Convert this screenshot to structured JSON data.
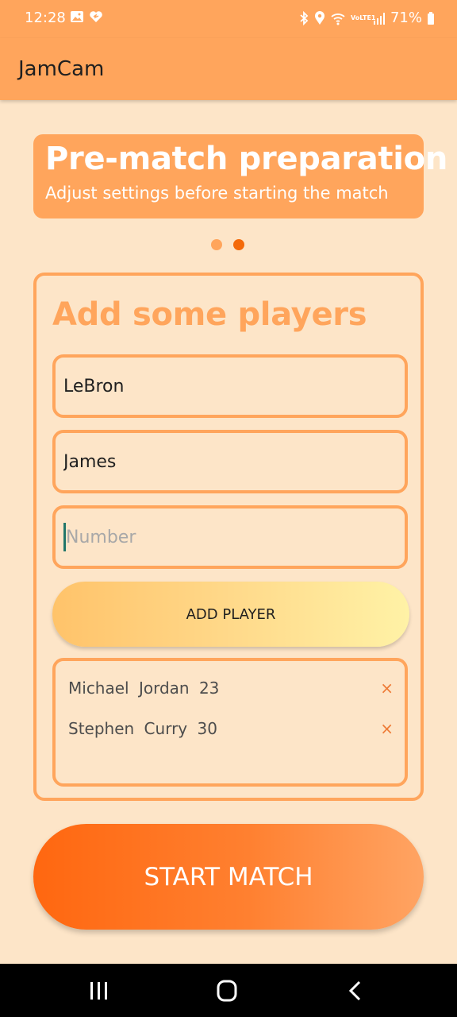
{
  "status_bar": {
    "time": "12:28",
    "battery": "71%",
    "icons": [
      "gallery-icon",
      "heart-icon",
      "bluetooth-icon",
      "location-icon",
      "wifi-icon",
      "volte-icon",
      "signal-icon",
      "battery-icon"
    ],
    "volte_text": "VoLTE1"
  },
  "app_bar": {
    "title": "JamCam"
  },
  "hero": {
    "title": "Pre-match preparation",
    "subtitle": "Adjust settings before starting the match"
  },
  "pager": {
    "total": 2,
    "active_index": 1
  },
  "card": {
    "title": "Add some players",
    "first_name_value": "LeBron",
    "last_name_value": "James",
    "number_placeholder": "Number",
    "add_button_label": "ADD PLAYER",
    "players": [
      {
        "label": "Michael  Jordan  23",
        "remove": "×"
      },
      {
        "label": "Stephen  Curry  30",
        "remove": "×"
      }
    ]
  },
  "start_button_label": "START MATCH",
  "nav": {
    "icons": [
      "recent-apps-icon",
      "home-icon",
      "back-icon"
    ]
  },
  "colors": {
    "background": "#fde5c8",
    "accent": "#ffa55c",
    "active_dot": "#f46a0a",
    "start_gradient": [
      "#ff6710",
      "#ffa463"
    ],
    "add_gradient": [
      "#ffc36a",
      "#fff2a6"
    ]
  }
}
